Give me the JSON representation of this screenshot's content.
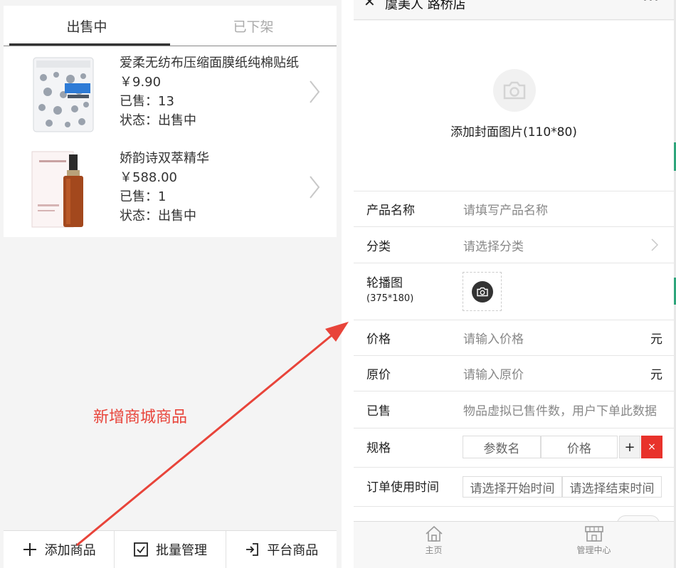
{
  "left": {
    "tabs": [
      {
        "label": "出售中",
        "active": true
      },
      {
        "label": "已下架",
        "active": false
      }
    ],
    "products": [
      {
        "name": "爱柔无纺布压缩面膜纸纯棉贴纸",
        "price": "￥9.90",
        "sold": "已售：13",
        "status": "状态：出售中"
      },
      {
        "name": "娇韵诗双萃精华",
        "price": "￥588.00",
        "sold": "已售：1",
        "status": "状态：出售中"
      }
    ],
    "bottom_bar": {
      "add_label": "添加商品",
      "batch_label": "批量管理",
      "platform_label": "平台商品"
    },
    "annotation": "新增商城商品"
  },
  "right": {
    "title": "虞美人 路桥店",
    "more": "···",
    "cover_text": "添加封面图片(110*80)",
    "fields": {
      "name_label": "产品名称",
      "name_placeholder": "请填写产品名称",
      "category_label": "分类",
      "category_placeholder": "请选择分类",
      "banner_label": "轮播图",
      "banner_size": "(375*180)",
      "price_label": "价格",
      "price_placeholder": "请输入价格",
      "price_unit": "元",
      "orig_label": "原价",
      "orig_placeholder": "请输入原价",
      "orig_unit": "元",
      "sold_label": "已售",
      "sold_placeholder": "物品虚拟已售件数，用户下单此数据",
      "spec_label": "规格",
      "spec_name_placeholder": "参数名",
      "spec_price_placeholder": "价格",
      "spec_add": "+",
      "spec_del": "×",
      "time_label": "订单使用时间",
      "time_start": "请选择开始时间",
      "time_end": "请选择结束时间"
    },
    "nav": [
      {
        "label": "主页",
        "icon": "home-icon"
      },
      {
        "label": "管理中心",
        "icon": "store-icon"
      }
    ]
  },
  "colors": {
    "annotation": "#e8443a",
    "delete": "#e8322b",
    "edge_mark": "#2fa57b"
  }
}
